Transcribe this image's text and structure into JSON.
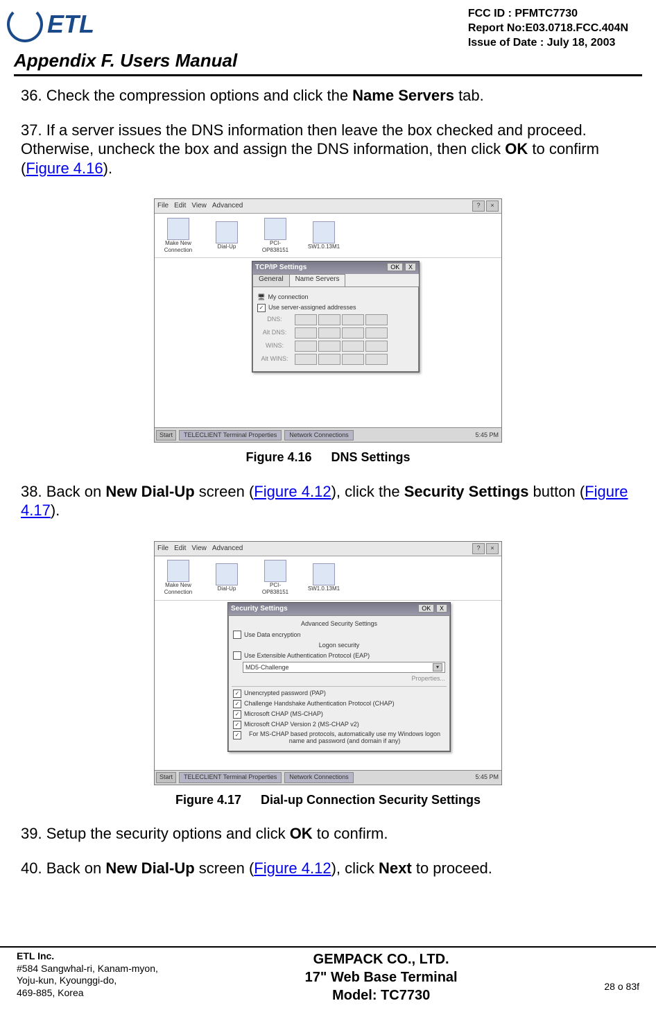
{
  "header": {
    "logo_text": "ETL",
    "meta1": "FCC ID : PFMTC7730",
    "meta2": "Report No:E03.0718.FCC.404N",
    "meta3": "Issue of Date : July 18, 2003",
    "appendix": "Appendix F.  Users Manual"
  },
  "steps": {
    "s36": {
      "num": "36.",
      "t1": "Check the compression options and click the ",
      "b1": "Name Servers",
      "t2": " tab."
    },
    "s37": {
      "num": "37.",
      "t1": "If a server issues the DNS information then leave the box checked and proceed. Otherwise, uncheck the box and assign the DNS information, then click ",
      "b1": "OK",
      "t2": " to confirm (",
      "l1": "Figure 4.16",
      "t3": ")."
    },
    "s38": {
      "num": "38.",
      "t1": "Back on ",
      "b1": "New Dial-Up",
      "t2": " screen (",
      "l1": "Figure 4.12",
      "t3": "), click the ",
      "b2": "Security Settings",
      "t4": " button (",
      "l2": "Figure 4.17",
      "t5": ")."
    },
    "s39": {
      "num": "39.",
      "t1": "Setup the security options and click ",
      "b1": "OK",
      "t2": " to confirm."
    },
    "s40": {
      "num": "40.",
      "t1": "Back on ",
      "b1": "New Dial-Up",
      "t2": " screen (",
      "l1": "Figure 4.12",
      "t3": "), click ",
      "b2": "Next",
      "t4": " to proceed."
    }
  },
  "fig16": {
    "caption_num": "Figure 4.16",
    "caption_txt": "DNS Settings",
    "menubar": {
      "file": "File",
      "edit": "Edit",
      "view": "View",
      "advanced": "Advanced"
    },
    "toolbar": {
      "i0": {
        "label": "Make New Connection"
      },
      "i1": {
        "label": "Dial-Up"
      },
      "i2": {
        "label_l1": "PCI-",
        "label_l2": "OP838151"
      },
      "i3": {
        "label": "SW1.0.13M1"
      }
    },
    "dialog": {
      "title": "TCP/IP Settings",
      "ok": "OK",
      "close": "X",
      "tab_general": "General",
      "tab_ns": "Name Servers",
      "conn_label": "My connection",
      "chk_use": "Use server-assigned addresses",
      "row_dns": "DNS:",
      "row_altdns": "Alt DNS:",
      "row_wins": "WINS:",
      "row_altwins": "Alt WINS:"
    },
    "taskbar": {
      "start": "Start",
      "task1": "TELECLIENT Terminal Properties",
      "task2": "Network Connections",
      "time": "5:45 PM"
    }
  },
  "fig17": {
    "caption_num": "Figure 4.17",
    "caption_txt": "Dial-up Connection Security Settings",
    "menubar": {
      "file": "File",
      "edit": "Edit",
      "view": "View",
      "advanced": "Advanced"
    },
    "toolbar": {
      "i0": {
        "label": "Make New Connection"
      },
      "i1": {
        "label": "Dial-Up"
      },
      "i2": {
        "label_l1": "PCI-",
        "label_l2": "OP838151"
      },
      "i3": {
        "label": "SW1.0.13M1"
      }
    },
    "dialog": {
      "title": "Security Settings",
      "ok": "OK",
      "close": "X",
      "subtitle": "Advanced Security Settings",
      "chk_encrypt": "Use Data encryption",
      "grp_logon": "Logon security",
      "chk_eap": "Use Extensible Authentication Protocol (EAP)",
      "combo_val": "MD5-Challenge",
      "btn_props": "Properties...",
      "chk_pap": "Unencrypted password (PAP)",
      "chk_chap": "Challenge Handshake Authentication Protocol (CHAP)",
      "chk_mschap": "Microsoft CHAP (MS-CHAP)",
      "chk_mschap2": "Microsoft CHAP Version 2 (MS-CHAP v2)",
      "chk_autologon": "For MS-CHAP based protocols, automatically use my Windows logon name and password (and domain if any)"
    },
    "taskbar": {
      "start": "Start",
      "task1": "TELECLIENT Terminal Properties",
      "task2": "Network Connections",
      "time": "5:45 PM"
    }
  },
  "footer": {
    "co": "ETL Inc.",
    "addr1": "#584 Sangwhal-ri, Kanam-myon,",
    "addr2": "Yoju-kun, Kyounggi-do,",
    "addr3": " 469-885, Korea",
    "center1": "GEMPACK CO., LTD.",
    "center2": "17\" Web Base Terminal",
    "center3": "Model: TC7730",
    "pagenum": "28 o 83f"
  }
}
